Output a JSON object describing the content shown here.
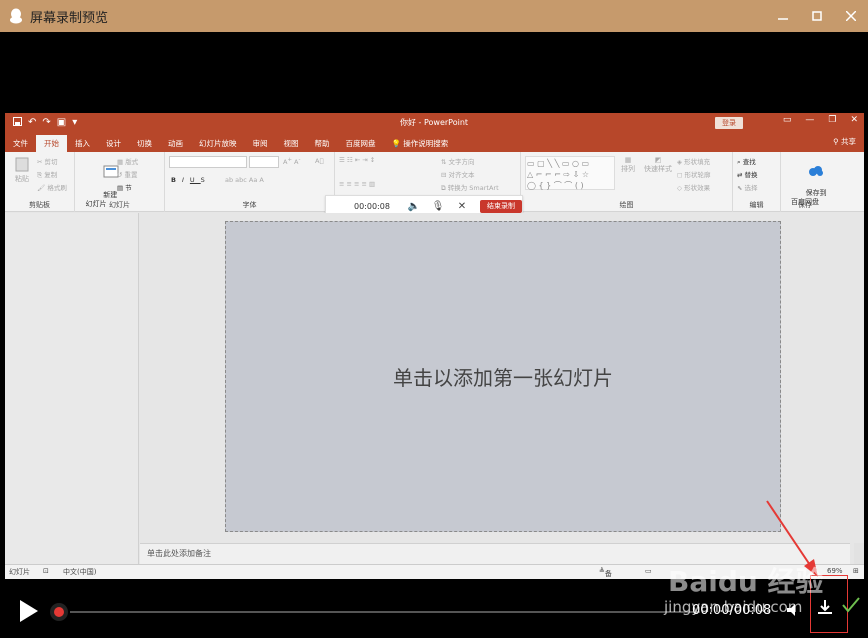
{
  "window": {
    "title": "屏幕录制预览",
    "controls": [
      "minimize",
      "maximize",
      "close"
    ]
  },
  "ppt": {
    "doc_title": "你好 - PowerPoint",
    "login_label": "登录",
    "tabs": [
      "文件",
      "开始",
      "插入",
      "设计",
      "切换",
      "动画",
      "幻灯片放映",
      "审阅",
      "视图",
      "帮助",
      "百度网盘",
      "操作说明搜索"
    ],
    "active_tab": "开始",
    "share_label": "共享",
    "ribbon": {
      "clipboard": {
        "paste": "粘贴",
        "cut": "剪切",
        "copy": "复制",
        "format_painter": "格式刷",
        "label": "剪贴板"
      },
      "slides": {
        "new_slide": "新建\n幻灯片",
        "layout": "版式",
        "reset": "重置",
        "section": "节",
        "label": "幻灯片"
      },
      "font": {
        "label": "字体"
      },
      "paragraph": {
        "text_direction": "文字方向",
        "align_text": "对齐文本",
        "smartart": "转换为 SmartArt"
      },
      "drawing": {
        "arrange": "排列",
        "quick_styles": "快速样式",
        "shape_fill": "形状填充",
        "shape_outline": "形状轮廓",
        "shape_effects": "形状效果",
        "label": "绘图"
      },
      "editing": {
        "find": "查找",
        "replace": "替换",
        "select": "选择",
        "label": "编辑"
      },
      "save": {
        "save_to": "保存到\n百度网盘",
        "label": "保存"
      }
    },
    "recorder": {
      "time": "00:00:08",
      "stop_label": "结束录制"
    },
    "slide_placeholder": "单击以添加第一张幻灯片",
    "notes_placeholder": "单击此处添加备注",
    "status": {
      "slide": "幻灯片",
      "language": "中文(中国)",
      "notes": "备注",
      "zoom": "69%"
    }
  },
  "player": {
    "time": "00:00/00:08",
    "progress": 0
  },
  "watermark": {
    "brand": "Baidu 经验",
    "url": "jingyan.baidu.com"
  }
}
